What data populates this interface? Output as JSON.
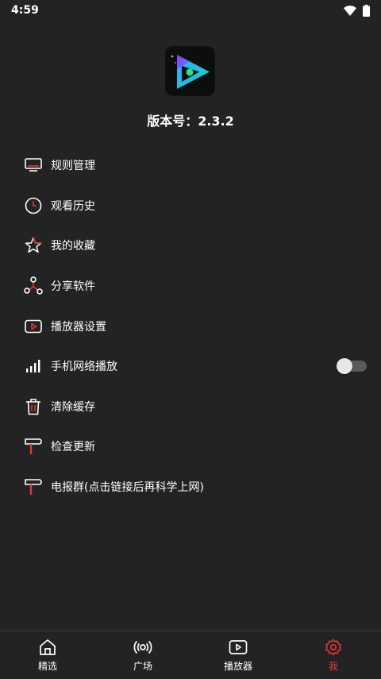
{
  "status_bar": {
    "time": "4:59"
  },
  "app": {
    "version_text": "版本号：2.3.2"
  },
  "menu": {
    "items": [
      {
        "label": "规则管理",
        "icon": "monitor-icon"
      },
      {
        "label": "观看历史",
        "icon": "clock-icon"
      },
      {
        "label": "我的收藏",
        "icon": "star-icon"
      },
      {
        "label": "分享软件",
        "icon": "share-icon"
      },
      {
        "label": "播放器设置",
        "icon": "play-box-icon"
      },
      {
        "label": "手机网络播放",
        "icon": "signal-icon",
        "toggle": false
      },
      {
        "label": "清除缓存",
        "icon": "trash-icon"
      },
      {
        "label": "检查更新",
        "icon": "paint-roller-icon"
      },
      {
        "label": "电报群(点击链接后再科学上网)",
        "icon": "paint-roller-icon"
      }
    ]
  },
  "bottom_nav": {
    "items": [
      {
        "label": "精选",
        "icon": "home-icon",
        "active": false
      },
      {
        "label": "广场",
        "icon": "broadcast-icon",
        "active": false
      },
      {
        "label": "播放器",
        "icon": "play-box-icon",
        "active": false
      },
      {
        "label": "我",
        "icon": "gear-icon",
        "active": true
      }
    ]
  },
  "colors": {
    "background": "#232323",
    "accent": "#e53935",
    "text": "#ffffff"
  }
}
